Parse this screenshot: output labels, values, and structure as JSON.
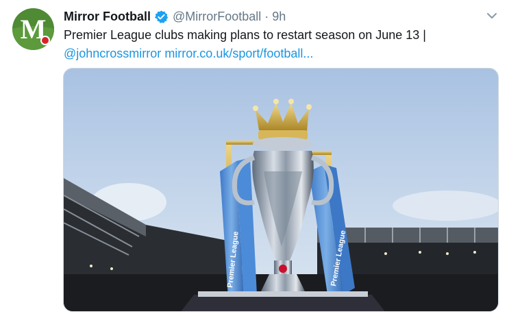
{
  "tweet": {
    "display_name": "Mirror Football",
    "handle": "@MirrorFootball",
    "separator": "·",
    "time": "9h",
    "verified": true,
    "avatar_letter": "M",
    "text_main": "Premier League clubs making plans to restart season on June 13 |",
    "mention": "@johncrossmirror",
    "url_link": "mirror.co.uk/sport/football...",
    "media": {
      "ribbon_text": "Premier League"
    }
  },
  "colors": {
    "link": "#1b95e0",
    "secondary_text": "#657786",
    "verified_badge": "#1da1f2",
    "avatar_bg": "#4f8a34"
  },
  "icons": {
    "verified": "verified-badge-icon",
    "chevron": "chevron-down-icon"
  }
}
